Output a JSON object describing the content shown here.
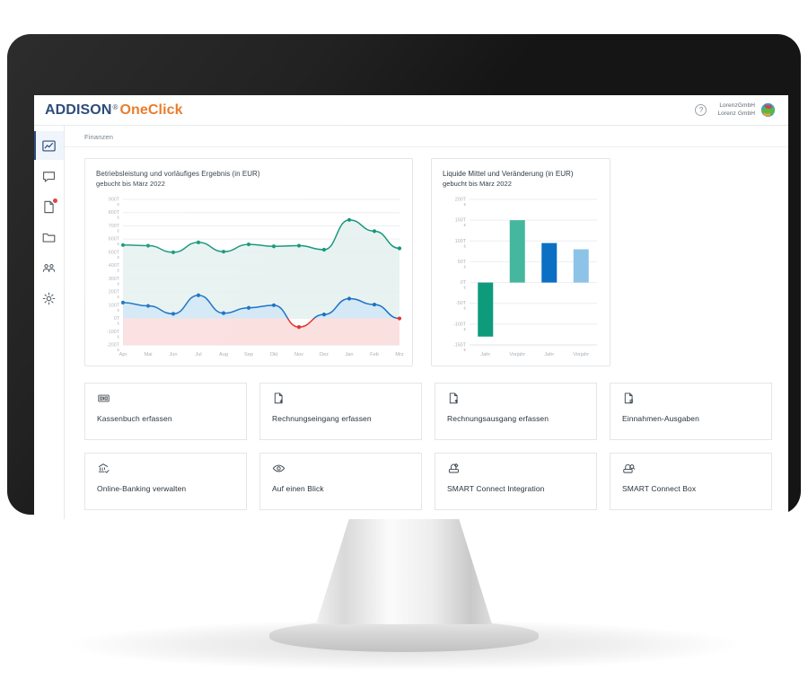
{
  "app": {
    "brand_primary": "ADDISON",
    "brand_registered": "®",
    "brand_secondary": "OneClick",
    "brand_primary_color": "#1b3c6e",
    "brand_secondary_color": "#e8731c"
  },
  "topbar": {
    "help_label": "?",
    "account": {
      "line1": "LorenzGmbH",
      "line2": "Lorenz GmbH"
    }
  },
  "sidebar": {
    "items": [
      {
        "name": "dashboard",
        "icon": "chart-line-icon",
        "active": true,
        "badge": false
      },
      {
        "name": "messages",
        "icon": "speech-bubble-icon",
        "active": false,
        "badge": false
      },
      {
        "name": "documents",
        "icon": "document-icon",
        "active": false,
        "badge": true
      },
      {
        "name": "folders",
        "icon": "folder-icon",
        "active": false,
        "badge": false
      },
      {
        "name": "contacts",
        "icon": "people-icon",
        "active": false,
        "badge": false
      },
      {
        "name": "settings",
        "icon": "gear-icon",
        "active": false,
        "badge": false
      }
    ]
  },
  "breadcrumb": {
    "label": "Finanzen"
  },
  "chart_data": [
    {
      "type": "line",
      "name": "betriebsleistung",
      "title": "Betriebsleistung und vorläufiges Ergebnis (in EUR)",
      "subtitle": "gebucht bis März 2022",
      "xlabel": "",
      "ylabel": "",
      "grid": true,
      "legend": "none",
      "ylim": [
        -200,
        900
      ],
      "ytick_unit": "T €",
      "yticks": [
        900,
        800,
        700,
        600,
        500,
        400,
        300,
        200,
        100,
        0,
        -100,
        -200
      ],
      "ytick_labels": [
        "900T €",
        "800T €",
        "700T €",
        "600T €",
        "500T €",
        "400T €",
        "300T €",
        "200T €",
        "100T €",
        "0T €",
        "-100T €",
        "-200T €"
      ],
      "categories": [
        "Apr",
        "Mai",
        "Jun",
        "Jul",
        "Aug",
        "Sep",
        "Okt",
        "Nov",
        "Dez",
        "Jan",
        "Feb",
        "Mrz"
      ],
      "series": [
        {
          "name": "Betriebsleistung",
          "color": "#16967c",
          "fill": "#e4f1ef",
          "values": [
            555,
            550,
            500,
            575,
            505,
            560,
            545,
            550,
            520,
            745,
            660,
            530
          ]
        },
        {
          "name": "Vorläufiges Ergebnis",
          "color": "#1a72c4",
          "fill": "#d3e7f5",
          "negative_color": "#e3342f",
          "negative_fill": "#fbe0e0",
          "values": [
            120,
            95,
            35,
            175,
            40,
            80,
            100,
            -65,
            30,
            150,
            105,
            0
          ]
        }
      ],
      "annotations": [
        {
          "kind": "endpoint-marker",
          "series": "Vorläufiges Ergebnis",
          "category": "Mrz",
          "color": "#e3342f"
        }
      ]
    },
    {
      "type": "bar",
      "name": "liquide-mittel",
      "title": "Liquide Mittel und Veränderung (in EUR)",
      "subtitle": "gebucht bis März 2022",
      "xlabel": "",
      "ylabel": "",
      "grid": true,
      "legend": "none",
      "ylim": [
        -150,
        200
      ],
      "ytick_unit": "T €",
      "yticks": [
        200,
        150,
        100,
        50,
        0,
        -50,
        -100,
        -150
      ],
      "ytick_labels": [
        "200T €",
        "150T €",
        "100T €",
        "50T €",
        "0T €",
        "-50T €",
        "-100T €",
        "-150T €"
      ],
      "categories": [
        "Jahr",
        "Vorjahr",
        "Jahr",
        "Vorjahr"
      ],
      "values": [
        -130,
        150,
        95,
        80
      ],
      "bar_colors": [
        "#0e9b7c",
        "#45b79f",
        "#0b6fc4",
        "#8ec3e8"
      ]
    }
  ],
  "tiles": [
    {
      "label": "Kassenbuch erfassen",
      "icon": "cashbook-icon"
    },
    {
      "label": "Rechnungseingang erfassen",
      "icon": "document-in-icon"
    },
    {
      "label": "Rechnungsausgang erfassen",
      "icon": "document-out-icon"
    },
    {
      "label": "Einnahmen-Ausgaben",
      "icon": "document-exchange-icon"
    },
    {
      "label": "Online-Banking verwalten",
      "icon": "bank-check-icon"
    },
    {
      "label": "Auf einen Blick",
      "icon": "eye-icon"
    },
    {
      "label": "SMART Connect Integration",
      "icon": "smart-connect-icon"
    },
    {
      "label": "SMART Connect Box",
      "icon": "smart-connect-box-icon"
    }
  ]
}
